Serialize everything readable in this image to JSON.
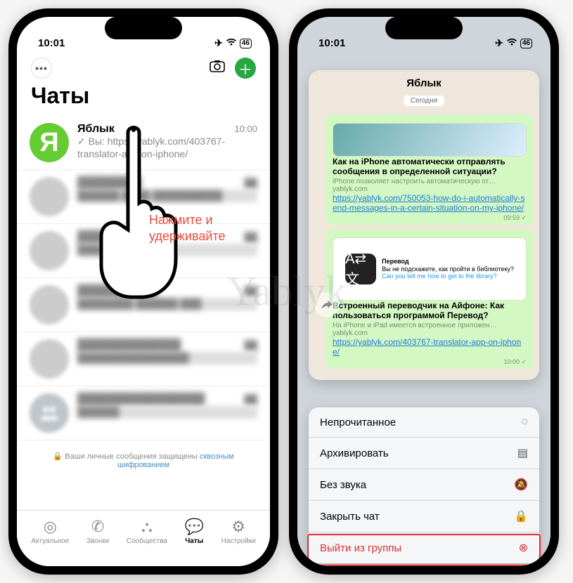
{
  "watermark": "Yablyk",
  "status": {
    "time": "10:01",
    "battery": "46"
  },
  "left": {
    "title": "Чаты",
    "hint": "Нажмите и\nудерживайте",
    "chat1": {
      "name": "Яблык",
      "time": "10:00",
      "avatar_letter": "Я",
      "msg": "✓ Вы: https://yablyk.com/403767-translator-app-on-iphone/"
    },
    "encrypted_prefix": "🔒 Ваши личные сообщения защищены ",
    "encrypted_link": "сквозным шифрованием",
    "tabs": {
      "actual": "Актуальное",
      "calls": "Звонки",
      "groups": "Сообщества",
      "chats": "Чаты",
      "settings": "Настройки"
    }
  },
  "right": {
    "preview_title": "Яблык",
    "date": "Сегодня",
    "msg1": {
      "headline": "Как на iPhone автоматически отправлять сообщения в определенной ситуации?",
      "sub": "iPhone позволяет настроить автоматическую от…",
      "host": "yablyk.com",
      "link": "https://yablyk.com/750053-how-do-i-automatically-send-messages-in-a-certain-situation-on-my-iphone/",
      "time": "09:59 ✓"
    },
    "msg2": {
      "inner_title": "Перевод",
      "inner_l1": "Вы не подскажете, как пройти в библиотеку?",
      "inner_l2": "Can you tell me how to get to the library?",
      "headline": "Встроенный переводчик на Айфоне: Как пользоваться программой Перевод?",
      "sub": "На iPhone и iPad имеется встроенное приложен…",
      "host": "yablyk.com",
      "link": "https://yablyk.com/403767-translator-app-on-iphone/",
      "time": "10:00 ✓"
    },
    "menu": {
      "unread": "Непрочитанное",
      "archive": "Архивировать",
      "mute": "Без звука",
      "close": "Закрыть чат",
      "leave": "Выйти из группы"
    }
  }
}
